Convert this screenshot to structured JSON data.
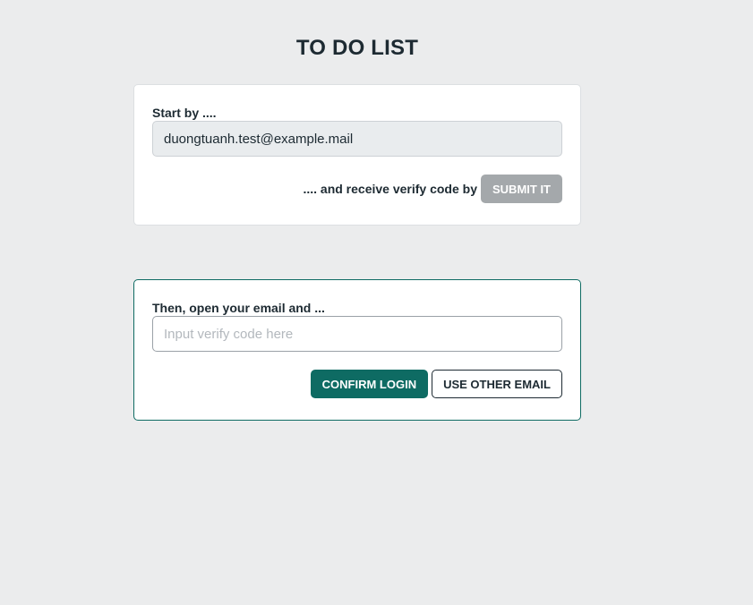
{
  "header": {
    "title": "TO DO LIST"
  },
  "email_step": {
    "label": "Start by ....",
    "email_value": "duongtuanh.test@example.mail",
    "hint": ".... and receive verify code by",
    "submit_label": "SUBMIT IT"
  },
  "verify_step": {
    "label": "Then, open your email and ...",
    "code_placeholder": "Input verify code here",
    "confirm_label": "CONFIRM LOGIN",
    "other_email_label": "USE OTHER EMAIL"
  },
  "colors": {
    "background": "#ebeced",
    "primary": "#0e6b63",
    "disabled": "#a4a8ab",
    "text": "#1d2a32"
  }
}
